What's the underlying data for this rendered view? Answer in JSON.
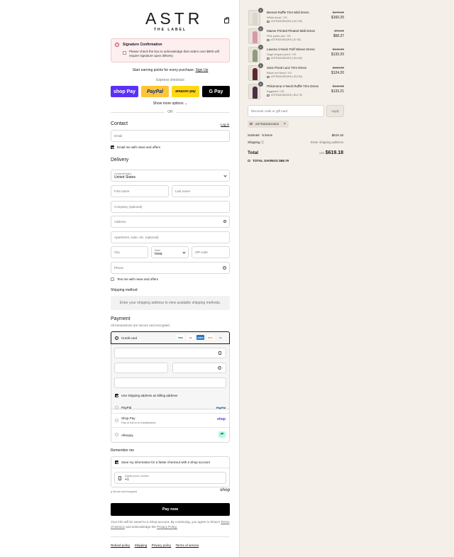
{
  "logo": {
    "main": "ASTR",
    "sub": "THE LABEL"
  },
  "signature": {
    "title": "Signature Confirmation",
    "body": "Please check the box to acknowledge that orders over $500 will require signature upon delivery."
  },
  "points": {
    "text": "Start earning points for every purchase.",
    "link": "Sign Up"
  },
  "express": {
    "label": "Express checkout",
    "buttons": [
      "shop Pay",
      "PayPal",
      "amazon pay",
      "G Pay"
    ],
    "more": "Show more options",
    "or": "OR"
  },
  "contact": {
    "heading": "Contact",
    "login": "Log in",
    "email_placeholder": "Email",
    "news_label": "Email me with news and offers"
  },
  "delivery": {
    "heading": "Delivery",
    "country_label": "Country/Region",
    "country_value": "United States",
    "first_name": "First name",
    "last_name": "Last name",
    "company": "Company (optional)",
    "address": "Address",
    "apartment": "Apartment, suite, etc. (optional)",
    "city": "City",
    "state_label": "State",
    "state_value": "Iowa",
    "zip": "ZIP code",
    "phone": "Phone",
    "text_label": "Text me with news and offers"
  },
  "shipping_method": {
    "heading": "Shipping method",
    "message": "Enter your shipping address to view available shipping methods."
  },
  "payment": {
    "heading": "Payment",
    "subtitle": "All transactions are secure and encrypted.",
    "credit_card": "Credit card",
    "card_logos": [
      "VISA",
      "MC",
      "AMEX",
      "DISC",
      "+4"
    ],
    "billing_label": "Use shipping address as billing address",
    "paypal": "PayPal",
    "paypal_logo": "PayPal",
    "shop_pay": "Shop Pay",
    "shop_pay_sub": "Pay in full or in installments",
    "shop_pay_logo": "shop",
    "afterpay": "Afterpay"
  },
  "remember": {
    "heading": "Remember me",
    "save_label": "Save my information for a faster checkout with a Shop account",
    "mobile_label": "Mobile phone number",
    "mobile_value": "+1",
    "secure": "Secure and encrypted",
    "shop_logo": "shop"
  },
  "pay_button": "Pay now",
  "consent": {
    "text": "Your info will be saved to a Shop account. By continuing, you agree to Shop's",
    "terms": "Terms of Service",
    "and": "and acknowledge the",
    "privacy": "Privacy Policy."
  },
  "footer_links": [
    "Refund policy",
    "Shipping",
    "Privacy policy",
    "Terms of service"
  ],
  "items": [
    {
      "qty": "1",
      "name": "Bennet Ruffle Trim Midi Dress",
      "variant": "White floral / XS",
      "code": "ASTRADD8242K8 (-$17.80)",
      "old": "$178.00",
      "new": "$160.20",
      "color": "#e9e4dc"
    },
    {
      "qty": "1",
      "name": "Maeve Printed Pleated Midi Dress",
      "variant": "Pink polka dot / XS",
      "code": "ASTRADD8242K8 (-$7.60)",
      "old": "$76.00",
      "new": "$68.37",
      "color": "#d79aa8"
    },
    {
      "qty": "1",
      "name": "Lavena V-Neck Puff Sleeve Dress",
      "variant": "Sage leopard print / XS",
      "code": "ASTRADD8242K8 (-$14.80)",
      "old": "$148.00",
      "new": "$133.20",
      "color": "#8f9a7e"
    },
    {
      "qty": "1",
      "name": "Sara Floral Lace Trim Dress",
      "variant": "Black red floral / XS",
      "code": "ASTRADD8242K8 (-$13.80)",
      "old": "$138.00",
      "new": "$124.20",
      "color": "#5a2b2e"
    },
    {
      "qty": "1",
      "name": "Philomena V-Neck Ruffle Trim Dress",
      "variant": "Eggplant / XS",
      "code": "ASTRADD8242K8 (-$14.79)",
      "old": "$148.00",
      "new": "$133.21",
      "color": "#4a3042"
    }
  ],
  "discount": {
    "placeholder": "Discount code or gift card",
    "apply": "Apply",
    "code": "ASTRADD8242K8"
  },
  "summary": {
    "subtotal_label": "Subtotal · 5 items",
    "subtotal_value": "$619.18",
    "shipping_label": "Shipping",
    "shipping_value": "Enter shipping address",
    "total_label": "Total",
    "currency": "USD",
    "total_value": "$619.18",
    "savings_label": "TOTAL SAVINGS",
    "savings_value": "$68.79"
  }
}
